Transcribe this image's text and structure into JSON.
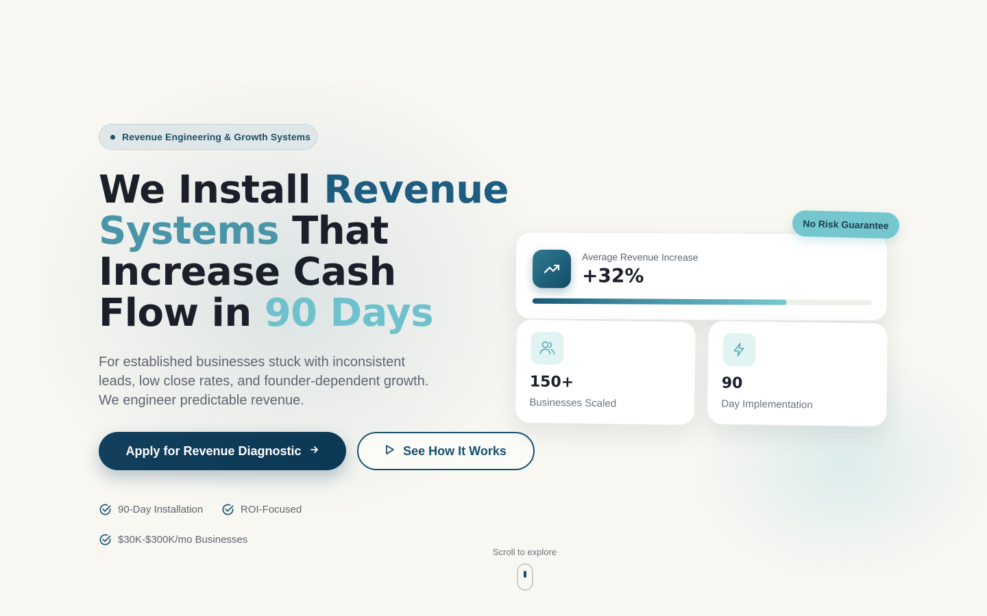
{
  "badge": {
    "text": "Revenue Engineering & Growth Systems"
  },
  "headline": {
    "line1_a": "We Install ",
    "line1_b": "Revenue",
    "line2_a": "Systems",
    "line2_b": " That",
    "line3": "Increase Cash",
    "line4_a": "Flow in ",
    "line4_b": "90",
    "line4_c": " Days"
  },
  "subtitle": "For established businesses stuck with inconsistent leads, low close rates, and founder-dependent growth. We engineer predictable revenue.",
  "buttons": {
    "primary_label": "Apply for Revenue Diagnostic",
    "secondary_label": "See How It Works"
  },
  "features": [
    {
      "label": "90-Day Installation"
    },
    {
      "label": "ROI-Focused"
    },
    {
      "label": "$30K-$300K/mo Businesses"
    }
  ],
  "stats_card": {
    "tag": "No Risk Guarantee",
    "label": "Average Revenue Increase",
    "value": "+32%",
    "progress_fraction": 0.75
  },
  "stats": [
    {
      "value": "150+",
      "label": "Businesses Scaled",
      "icon": "users-icon"
    },
    {
      "value": "90",
      "label": "Day Implementation",
      "icon": "lightning-icon"
    }
  ],
  "scroll": {
    "text": "Scroll to explore"
  },
  "colors": {
    "primary": "#123f5c",
    "accent_teal": "#6fc2cc",
    "dark_teal": "#1e5d80",
    "background": "#f8f7f2"
  }
}
